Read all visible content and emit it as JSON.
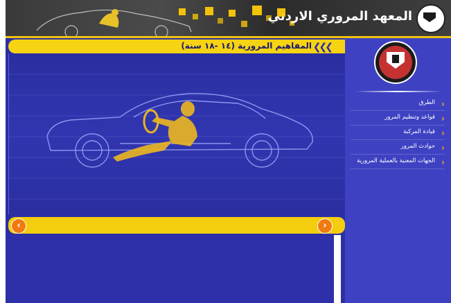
{
  "header": {
    "title": "المعهد المروري الاردني"
  },
  "section": {
    "title": "المفاهيم المرورية (١٤ -١٨ سنة)",
    "arrows": "❮❮❮"
  },
  "nav": {
    "prev": "‹",
    "next": "›"
  },
  "sidebar": {
    "items": [
      {
        "label": "الطرق"
      },
      {
        "label": "قواعد وتنظيم المرور"
      },
      {
        "label": "قيادة المركبة"
      },
      {
        "label": "حوادث المرور"
      },
      {
        "label": "الجهات المعنية بالعملية المرورية"
      }
    ],
    "chevron": "‹"
  },
  "colors": {
    "accent": "#f4cd0e",
    "main_bg": "#2b2fa6",
    "sidebar_bg": "#3e42c2",
    "chevron": "#f5a623"
  }
}
